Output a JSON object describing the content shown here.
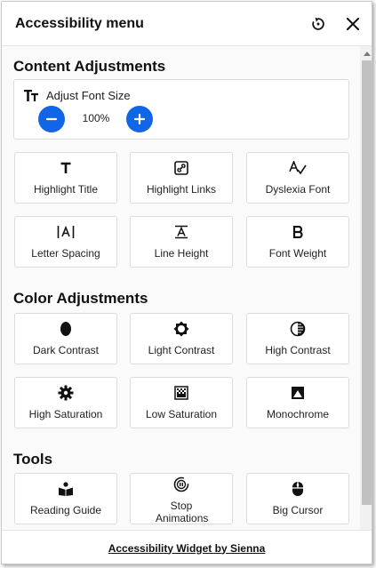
{
  "header": {
    "title": "Accessibility menu",
    "reset_icon": "reset-icon",
    "close_icon": "close-icon"
  },
  "content_adjustments": {
    "title": "Content Adjustments",
    "font_size": {
      "label": "Adjust Font Size",
      "value": "100%"
    },
    "tiles": [
      {
        "label": "Highlight Title",
        "icon": "title-icon"
      },
      {
        "label": "Highlight Links",
        "icon": "link-icon"
      },
      {
        "label": "Dyslexia Font",
        "icon": "dyslexia-icon"
      },
      {
        "label": "Letter Spacing",
        "icon": "letter-spacing-icon"
      },
      {
        "label": "Line Height",
        "icon": "line-height-icon"
      },
      {
        "label": "Font Weight",
        "icon": "bold-icon"
      }
    ]
  },
  "color_adjustments": {
    "title": "Color Adjustments",
    "tiles": [
      {
        "label": "Dark Contrast",
        "icon": "dark-contrast-icon"
      },
      {
        "label": "Light Contrast",
        "icon": "light-contrast-icon"
      },
      {
        "label": "High Contrast",
        "icon": "high-contrast-icon"
      },
      {
        "label": "High Saturation",
        "icon": "high-saturation-icon"
      },
      {
        "label": "Low Saturation",
        "icon": "low-saturation-icon"
      },
      {
        "label": "Monochrome",
        "icon": "monochrome-icon"
      }
    ]
  },
  "tools": {
    "title": "Tools",
    "tiles": [
      {
        "label": "Reading Guide",
        "icon": "reading-guide-icon"
      },
      {
        "label": "Stop Animations",
        "icon": "stop-animations-icon"
      },
      {
        "label": "Big Cursor",
        "icon": "mouse-icon"
      }
    ]
  },
  "footer": {
    "link_text": "Accessibility Widget by Sienna"
  },
  "colors": {
    "accent": "#1166e8",
    "panel_bg": "#fafafa",
    "tile_border": "#dcdcdc"
  }
}
